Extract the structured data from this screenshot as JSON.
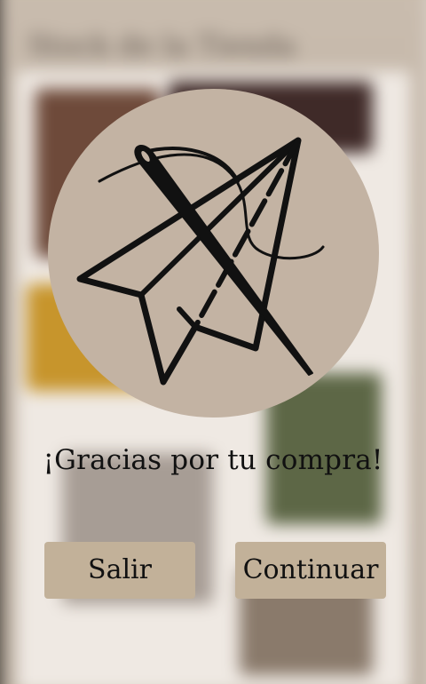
{
  "background": {
    "title": "Stock de la Tienda"
  },
  "dialog": {
    "logo_icon": "needle-paper-plane-icon",
    "message": "¡Gracias por tu compra!",
    "buttons": {
      "exit_label": "Salir",
      "continue_label": "Continuar"
    }
  },
  "colors": {
    "logo_circle": "#c3b3a3",
    "button_fill": "#c2b199",
    "text": "#111111"
  }
}
